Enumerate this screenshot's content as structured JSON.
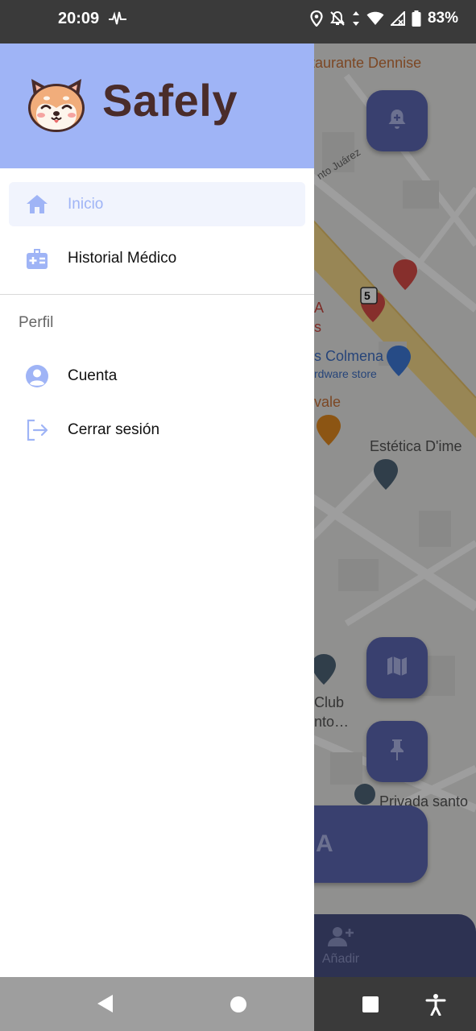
{
  "status_bar": {
    "time": "20:09",
    "battery": "83%",
    "icons": [
      "heartbeat-icon",
      "location-icon",
      "bell-off-icon",
      "data-arrows-icon",
      "wifi-icon",
      "signal-icon",
      "battery-icon"
    ]
  },
  "drawer": {
    "brand_name": "Safely",
    "logo_icon": "shiba-dog-logo",
    "items": [
      {
        "label": "Inicio",
        "icon": "home-icon",
        "active": true
      },
      {
        "label": "Historial Médico",
        "icon": "medical-kit-icon",
        "active": false
      }
    ],
    "section_title": "Perfil",
    "profile_items": [
      {
        "label": "Cuenta",
        "icon": "user-circle-icon"
      },
      {
        "label": "Cerrar sesión",
        "icon": "logout-icon"
      }
    ]
  },
  "map": {
    "labels": [
      "taurante Dennise",
      "nto Juárez",
      "A",
      "s",
      "s Colmena",
      "rdware store",
      "vale",
      "Estética D'ime",
      "Club",
      "nto…",
      "Privada santo"
    ],
    "route_shield": "5"
  },
  "background_ui": {
    "pill_text": "A",
    "bottom_nav_label": "Añadir"
  },
  "colors": {
    "drawer_header": "#9fb4f6",
    "accent": "#9fb4f6",
    "brand_text": "#4a2c2a",
    "fab": "#5c68b4",
    "active_item_bg": "#f1f4fd"
  }
}
